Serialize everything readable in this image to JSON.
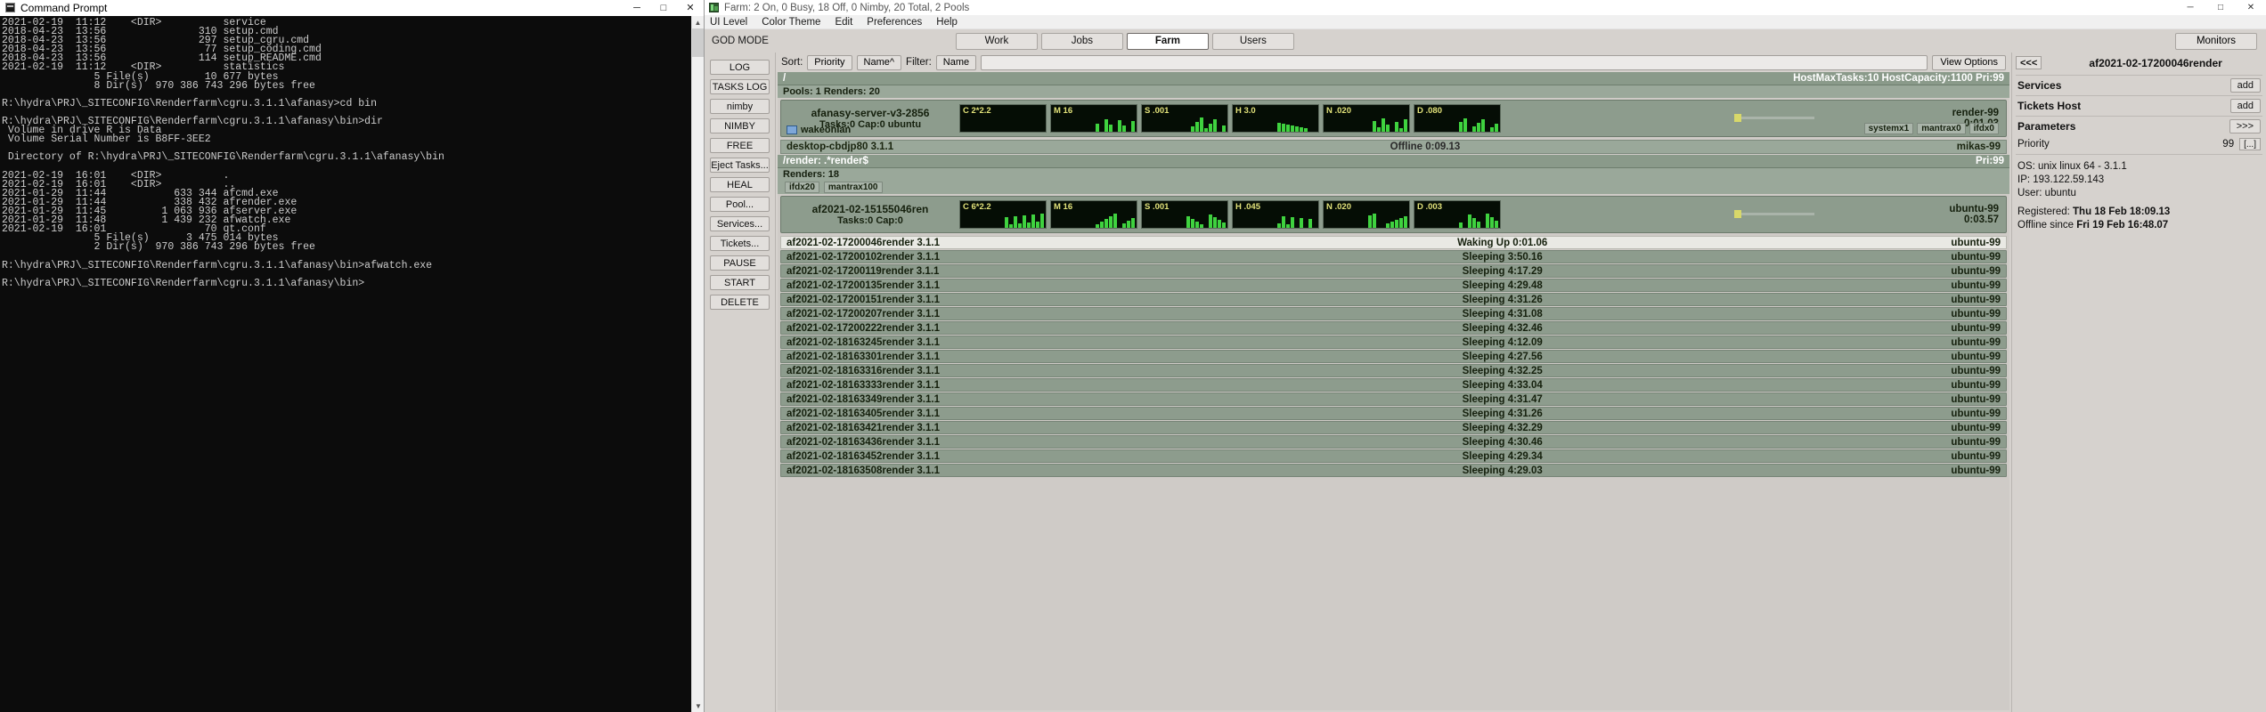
{
  "cmd": {
    "title": "Command Prompt",
    "icon": "cmd-icon",
    "window_buttons": {
      "minimize": "─",
      "maximize": "□",
      "close": "✕"
    },
    "lines": [
      "2021-02-19  11:12    <DIR>          service",
      "2018-04-23  13:56               310 setup.cmd",
      "2018-04-23  13:56               297 setup_cgru.cmd",
      "2018-04-23  13:56                77 setup_coding.cmd",
      "2018-04-23  13:56               114 setup_README.cmd",
      "2021-02-19  11:12    <DIR>          statistics",
      "               5 File(s)         10 677 bytes",
      "               8 Dir(s)  970 386 743 296 bytes free",
      "",
      "R:\\hydra\\PRJ\\_SITECONFIG\\Renderfarm\\cgru.3.1.1\\afanasy>cd bin",
      "",
      "R:\\hydra\\PRJ\\_SITECONFIG\\Renderfarm\\cgru.3.1.1\\afanasy\\bin>dir",
      " Volume in drive R is Data",
      " Volume Serial Number is B8FF-3EE2",
      "",
      " Directory of R:\\hydra\\PRJ\\_SITECONFIG\\Renderfarm\\cgru.3.1.1\\afanasy\\bin",
      "",
      "2021-02-19  16:01    <DIR>          .",
      "2021-02-19  16:01    <DIR>          ..",
      "2021-01-29  11:44           633 344 afcmd.exe",
      "2021-01-29  11:44           338 432 afrender.exe",
      "2021-01-29  11:45         1 063 936 afserver.exe",
      "2021-01-29  11:48         1 439 232 afwatch.exe",
      "2021-02-19  16:01                70 qt.conf",
      "               5 File(s)      3 475 014 bytes",
      "               2 Dir(s)  970 386 743 296 bytes free",
      "",
      "R:\\hydra\\PRJ\\_SITECONFIG\\Renderfarm\\cgru.3.1.1\\afanasy\\bin>afwatch.exe",
      "",
      "R:\\hydra\\PRJ\\_SITECONFIG\\Renderfarm\\cgru.3.1.1\\afanasy\\bin>"
    ],
    "scroll": {
      "up": "▲",
      "down": "▼"
    }
  },
  "afanasy": {
    "title": "Farm: 2 On, 0 Busy, 18 Off, 0 Nimby, 20 Total, 2 Pools",
    "icon": "afanasy-icon",
    "window_buttons": {
      "minimize": "─",
      "maximize": "□",
      "close": "✕"
    },
    "menu": [
      {
        "label": "UI Level",
        "underline": "L"
      },
      {
        "label": "Color Theme",
        "underline": "T"
      },
      {
        "label": "Edit",
        "underline": "E"
      },
      {
        "label": "Preferences",
        "underline": "P"
      },
      {
        "label": "Help",
        "underline": "H"
      }
    ],
    "mode_label": "GOD MODE",
    "tabs": [
      {
        "label": "Work",
        "active": false
      },
      {
        "label": "Jobs",
        "active": false
      },
      {
        "label": "Farm",
        "active": true
      },
      {
        "label": "Users",
        "active": false
      }
    ],
    "monitors_button": "Monitors",
    "left_buttons": [
      "LOG",
      "TASKS LOG",
      "nimby",
      "NIMBY",
      "FREE",
      "Eject Tasks...",
      "HEAL",
      "Pool...",
      "Services...",
      "Tickets...",
      "PAUSE",
      "START",
      "DELETE"
    ],
    "sortbar": {
      "sort_label": "Sort:",
      "sort_buttons": [
        "Priority",
        "Name^"
      ],
      "filter_label": "Filter:",
      "filter_buttons": [
        "Name"
      ],
      "filter_value": "",
      "filter_placeholder": "",
      "view_options": "View Options"
    },
    "root_branch": {
      "path": "/",
      "stats": "HostMaxTasks:10 HostCapacity:1100 Pri:99",
      "summary": "Pools: 1 Renders: 20"
    },
    "server_node": {
      "name": "afanasy-server-v3-2856",
      "sub": "Tasks:0 Cap:0 ubuntu",
      "wakeonlan": "wakeonlan",
      "host": "render-99",
      "time": "0:01.03",
      "graphs": [
        {
          "label": "C 2*2.2"
        },
        {
          "label": "M 16"
        },
        {
          "label": "S .001"
        },
        {
          "label": "H 3.0"
        },
        {
          "label": "N .020"
        },
        {
          "label": "D .080"
        }
      ],
      "tags": [
        "systemx1",
        "mantrax0",
        "ifdx0"
      ]
    },
    "offline_row": {
      "name": "desktop-cbdjp80 3.1.1",
      "status": "Offline 0:09.13",
      "host": "mikas-99"
    },
    "render_branch": {
      "path": "/render: .*render$",
      "priority": "Pri:99",
      "renders": "Renders: 18",
      "tags": [
        "ifdx20",
        "mantrax100"
      ]
    },
    "pool_node": {
      "name": "af2021-02-15155046ren",
      "sub": "Tasks:0 Cap:0",
      "host": "ubuntu-99",
      "time": "0:03.57",
      "graphs": [
        {
          "label": "C 6*2.2"
        },
        {
          "label": "M 16"
        },
        {
          "label": "S .001"
        },
        {
          "label": "H .045"
        },
        {
          "label": "N .020"
        },
        {
          "label": "D .003"
        }
      ]
    },
    "render_rows": [
      {
        "name": "af2021-02-17200046render 3.1.1",
        "status": "Waking Up 0:01.06",
        "host": "ubuntu-99",
        "highlight": true
      },
      {
        "name": "af2021-02-17200102render 3.1.1",
        "status": "Sleeping 3:50.16",
        "host": "ubuntu-99",
        "highlight": false
      },
      {
        "name": "af2021-02-17200119render 3.1.1",
        "status": "Sleeping 4:17.29",
        "host": "ubuntu-99",
        "highlight": false
      },
      {
        "name": "af2021-02-17200135render 3.1.1",
        "status": "Sleeping 4:29.48",
        "host": "ubuntu-99",
        "highlight": false
      },
      {
        "name": "af2021-02-17200151render 3.1.1",
        "status": "Sleeping 4:31.26",
        "host": "ubuntu-99",
        "highlight": false
      },
      {
        "name": "af2021-02-17200207render 3.1.1",
        "status": "Sleeping 4:31.08",
        "host": "ubuntu-99",
        "highlight": false
      },
      {
        "name": "af2021-02-17200222render 3.1.1",
        "status": "Sleeping 4:32.46",
        "host": "ubuntu-99",
        "highlight": false
      },
      {
        "name": "af2021-02-18163245render 3.1.1",
        "status": "Sleeping 4:12.09",
        "host": "ubuntu-99",
        "highlight": false
      },
      {
        "name": "af2021-02-18163301render 3.1.1",
        "status": "Sleeping 4:27.56",
        "host": "ubuntu-99",
        "highlight": false
      },
      {
        "name": "af2021-02-18163316render 3.1.1",
        "status": "Sleeping 4:32.25",
        "host": "ubuntu-99",
        "highlight": false
      },
      {
        "name": "af2021-02-18163333render 3.1.1",
        "status": "Sleeping 4:33.04",
        "host": "ubuntu-99",
        "highlight": false
      },
      {
        "name": "af2021-02-18163349render 3.1.1",
        "status": "Sleeping 4:31.47",
        "host": "ubuntu-99",
        "highlight": false
      },
      {
        "name": "af2021-02-18163405render 3.1.1",
        "status": "Sleeping 4:31.26",
        "host": "ubuntu-99",
        "highlight": false
      },
      {
        "name": "af2021-02-18163421render 3.1.1",
        "status": "Sleeping 4:32.29",
        "host": "ubuntu-99",
        "highlight": false
      },
      {
        "name": "af2021-02-18163436render 3.1.1",
        "status": "Sleeping 4:30.46",
        "host": "ubuntu-99",
        "highlight": false
      },
      {
        "name": "af2021-02-18163452render 3.1.1",
        "status": "Sleeping 4:29.34",
        "host": "ubuntu-99",
        "highlight": false
      },
      {
        "name": "af2021-02-18163508render 3.1.1",
        "status": "Sleeping 4:29.03",
        "host": "ubuntu-99",
        "highlight": false
      }
    ],
    "right_panel": {
      "back_button": "<<<",
      "node_title": "af2021-02-17200046render",
      "services": {
        "label": "Services",
        "add": "add"
      },
      "tickets_host": {
        "label": "Tickets Host",
        "add": "add"
      },
      "parameters": {
        "label": "Parameters",
        "expand": ">>>"
      },
      "priority": {
        "label": "Priority",
        "value": "99",
        "dots": "[...]"
      },
      "info": [
        {
          "label": "OS:",
          "value": "unix linux 64 - 3.1.1"
        },
        {
          "label": "IP:",
          "value": "193.122.59.143"
        },
        {
          "label": "User:",
          "value": "ubuntu"
        }
      ],
      "registered_label": "Registered:",
      "registered_value": "Thu 18 Feb 18:09.13",
      "offline_label": "Offline since",
      "offline_value": "Fri 19 Feb 16:48.07"
    }
  }
}
